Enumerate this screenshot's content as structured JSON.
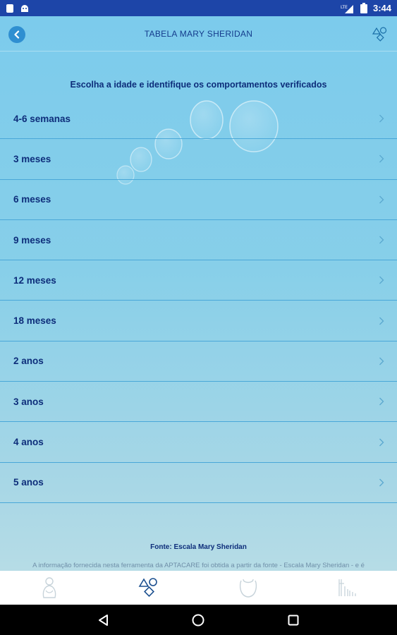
{
  "status_bar": {
    "time": "3:44",
    "network": "LTE",
    "icons": [
      "notification-icon",
      "android-icon",
      "signal-icon",
      "battery-icon"
    ]
  },
  "header": {
    "title": "TABELA MARY SHERIDAN",
    "back_icon": "chevron-left-icon",
    "right_icon": "shapes-icon"
  },
  "subtitle": "Escolha a idade e identifique os comportamentos verificados",
  "ages": [
    {
      "label": "4-6 semanas"
    },
    {
      "label": "3 meses"
    },
    {
      "label": "6 meses"
    },
    {
      "label": "9 meses"
    },
    {
      "label": "12 meses"
    },
    {
      "label": "18 meses"
    },
    {
      "label": "2 anos"
    },
    {
      "label": "3 anos"
    },
    {
      "label": "4 anos"
    },
    {
      "label": "5 anos"
    }
  ],
  "source": "Fonte: Escala Mary Sheridan",
  "disclaimer": "A informação fornecida nesta ferramenta da APTACARE foi obtida a partir da fonte - Escala Mary Sheridan - e é",
  "bottom_nav": [
    {
      "name": "baby-icon",
      "active": false
    },
    {
      "name": "shapes-icon",
      "active": true
    },
    {
      "name": "bib-icon",
      "active": false
    },
    {
      "name": "growth-chart-icon",
      "active": false
    }
  ],
  "colors": {
    "status_bar": "#1d45a8",
    "text_primary": "#0d2d7a",
    "divider": "#49a7d8",
    "back_button": "#2f8fd1",
    "nav_active": "#1b4f8f",
    "nav_inactive": "#c7d3da"
  }
}
